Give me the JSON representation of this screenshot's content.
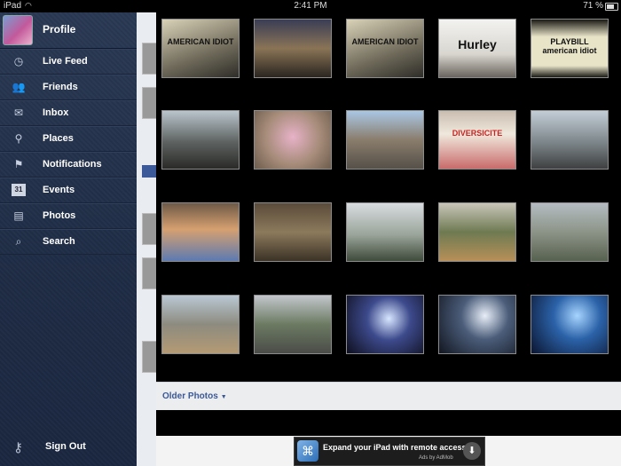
{
  "status_bar": {
    "device": "iPad",
    "time": "2:41 PM",
    "battery": "71 %"
  },
  "sidebar": {
    "profile_label": "Profile",
    "items": [
      {
        "label": "Live Feed",
        "icon": "clock-icon"
      },
      {
        "label": "Friends",
        "icon": "friends-icon"
      },
      {
        "label": "Inbox",
        "icon": "envelope-icon"
      },
      {
        "label": "Places",
        "icon": "pin-icon"
      },
      {
        "label": "Notifications",
        "icon": "flag-icon"
      },
      {
        "label": "Events",
        "icon": "calendar-icon",
        "icon_text": "31"
      },
      {
        "label": "Photos",
        "icon": "photos-icon"
      },
      {
        "label": "Search",
        "icon": "search-icon"
      }
    ],
    "sign_out_label": "Sign Out"
  },
  "photos": [
    {
      "tag": "AMERICAN IDIOT"
    },
    {
      "tag": ""
    },
    {
      "tag": "AMERICAN IDIOT"
    },
    {
      "tag": "Hurley"
    },
    {
      "tag": "PLAYBILL american idiot"
    },
    {
      "tag": ""
    },
    {
      "tag": ""
    },
    {
      "tag": ""
    },
    {
      "tag": "DIVERSICITE"
    },
    {
      "tag": ""
    },
    {
      "tag": ""
    },
    {
      "tag": ""
    },
    {
      "tag": ""
    },
    {
      "tag": ""
    },
    {
      "tag": ""
    },
    {
      "tag": ""
    },
    {
      "tag": ""
    },
    {
      "tag": ""
    },
    {
      "tag": ""
    },
    {
      "tag": ""
    }
  ],
  "older_photos_label": "Older Photos",
  "ad": {
    "title": "Expand your iPad with remote access",
    "sub": "Ads by AdMob"
  }
}
